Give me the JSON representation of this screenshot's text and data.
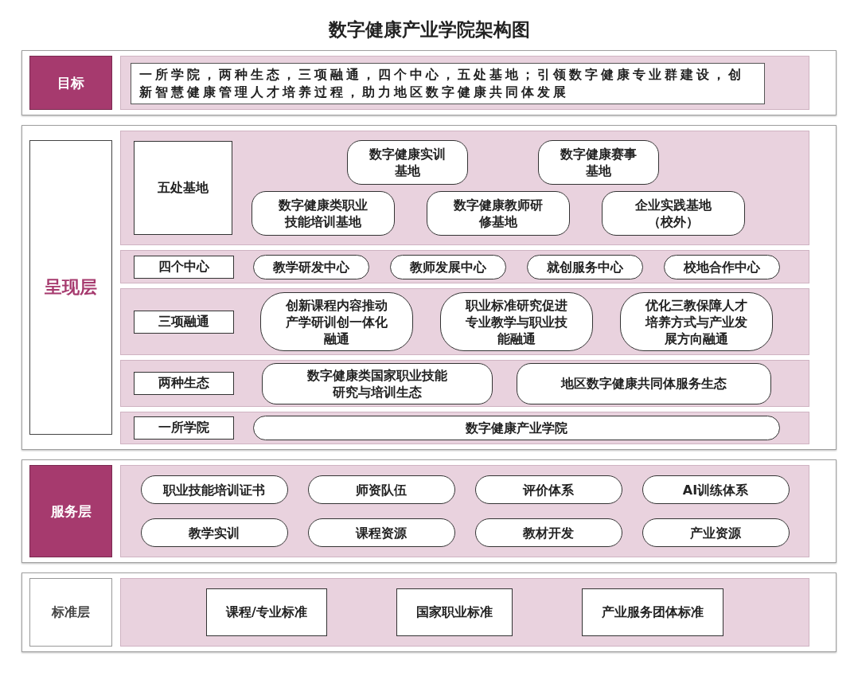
{
  "title": "数字健康产业学院架构图",
  "layers": [
    {
      "kind": "goal",
      "label": {
        "text": "目标",
        "kind": "filled"
      },
      "text": "一所学院，两种生态，三项融通，四个中心，五处基地；引领数字健康专业群建设，创新智慧健康管理人才培养过程，助力地区数字健康共同体发展"
    },
    {
      "kind": "rows",
      "label": {
        "text": "呈现层",
        "kind": "outlined"
      },
      "rows": [
        {
          "label": "五处基地",
          "lines": [
            [
              "数字健康实训基地",
              "数字健康赛事基地"
            ],
            [
              "数字健康类职业技能培训基地",
              "数字健康教师研修基地",
              "企业实践基地（校外）"
            ]
          ]
        },
        {
          "label": "四个中心",
          "lines": [
            [
              "教学研发中心",
              "教师发展中心",
              "就创服务中心",
              "校地合作中心"
            ]
          ]
        },
        {
          "label": "三项融通",
          "lines": [
            [
              "创新课程内容推动产学研训创一体化融通",
              "职业标准研究促进专业教学与职业技能融通",
              "优化三教保障人才培养方式与产业发展方向融通"
            ]
          ]
        },
        {
          "label": "两种生态",
          "lines": [
            [
              "数字健康类国家职业技能研究与培训生态",
              "地区数字健康共同体服务生态"
            ]
          ]
        },
        {
          "label": "一所学院",
          "lines": [
            [
              "数字健康产业学院"
            ]
          ]
        }
      ]
    },
    {
      "kind": "grid",
      "label": {
        "text": "服务层",
        "kind": "filled"
      },
      "items": [
        "职业技能培训证书",
        "师资队伍",
        "评价体系",
        "AI训练体系",
        "教学实训",
        "课程资源",
        "教材开发",
        "产业资源"
      ]
    },
    {
      "kind": "boxes",
      "label": {
        "text": "标准层",
        "kind": "plain"
      },
      "items": [
        "课程/专业标准",
        "国家职业标准",
        "产业服务团体标准"
      ]
    }
  ]
}
